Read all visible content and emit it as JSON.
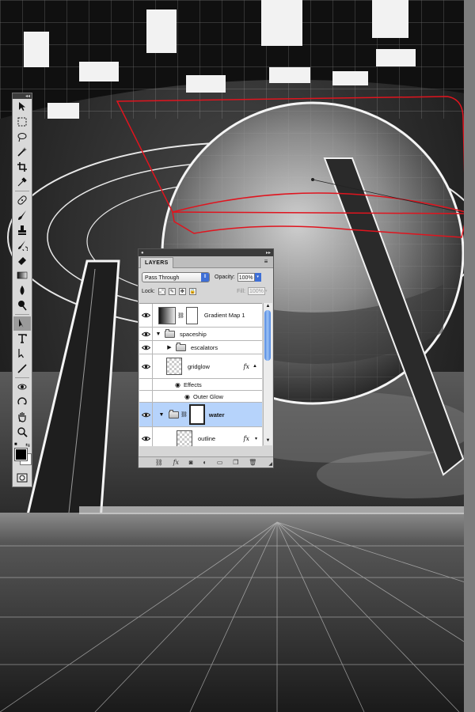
{
  "layers_panel": {
    "tab_label": "LAYERS",
    "blend_mode": "Pass Through",
    "opacity_label": "Opacity:",
    "opacity_value": "100%",
    "lock_label": "Lock:",
    "fill_label": "Fill:",
    "fill_value": "100%",
    "layers": [
      {
        "name": "Gradient Map 1",
        "type": "adjustment",
        "visible": true
      },
      {
        "name": "spaceship",
        "type": "group",
        "expanded": true,
        "visible": true
      },
      {
        "name": "escalators",
        "type": "group",
        "expanded": false,
        "visible": true
      },
      {
        "name": "gridglow",
        "type": "layer",
        "visible": true,
        "fx": "fx"
      },
      {
        "name": "Effects",
        "type": "effects-header"
      },
      {
        "name": "Outer Glow",
        "type": "effect"
      },
      {
        "name": "water",
        "type": "group",
        "expanded": true,
        "visible": true,
        "selected": true
      },
      {
        "name": "outline",
        "type": "layer",
        "visible": true,
        "fx": "fx"
      }
    ],
    "footer_icons": [
      "link-icon",
      "fx-icon",
      "mask-icon",
      "adjustment-icon",
      "group-icon",
      "new-layer-icon",
      "trash-icon"
    ]
  },
  "tools": [
    "move-tool-icon",
    "marquee-tool-icon",
    "lasso-tool-icon",
    "magic-wand-icon",
    "crop-tool-icon",
    "eyedropper-icon",
    "healing-brush-icon",
    "brush-tool-icon",
    "clone-stamp-icon",
    "history-brush-icon",
    "eraser-icon",
    "gradient-tool-icon",
    "blur-tool-icon",
    "dodge-tool-icon",
    "pen-tool-icon",
    "type-tool-icon",
    "path-selection-icon",
    "line-tool-icon",
    "3d-rotate-icon",
    "3d-orbit-icon",
    "hand-tool-icon",
    "zoom-tool-icon"
  ],
  "colors": {
    "foreground": "#000000",
    "background": "#ffffff",
    "selection": "#b6d3fb",
    "path": "#e0141e"
  }
}
